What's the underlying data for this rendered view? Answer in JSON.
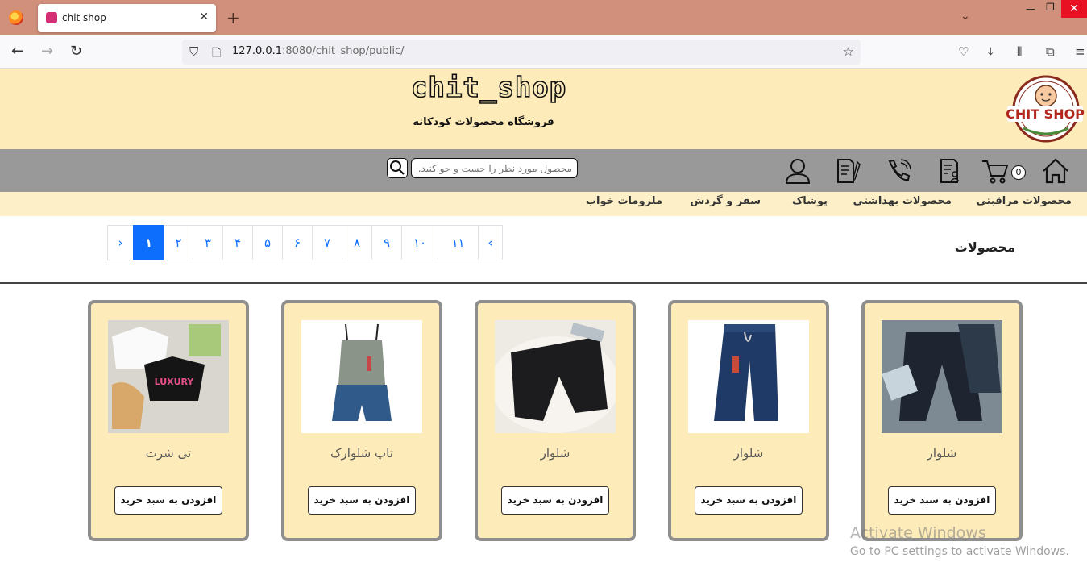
{
  "browser": {
    "tab_title": "chit shop",
    "url_host": "127.0.0.1",
    "url_rest": ":8080/chit_shop/public/",
    "accent": "#d0907c"
  },
  "site": {
    "brand": "chit_shop",
    "subtitle": "فروشگاه محصولات کودکانه",
    "logo_text": "CHIT SHOP",
    "header_bg": "#fdebb9",
    "iconbar_bg": "#999999",
    "search_placeholder": "محصول مورد نظر را جست و جو کنید...",
    "cart_count": "0",
    "icons": [
      "home-icon",
      "cart-icon",
      "document-user-icon",
      "phone-icon",
      "document-edit-icon",
      "user-icon",
      "search-icon"
    ]
  },
  "categories": [
    "محصولات مراقبتی",
    "محصولات بهداشتی",
    "پوشاک",
    "سفر و گردش",
    "ملزومات خواب"
  ],
  "products_heading": "محصولات",
  "pagination": {
    "prev": "‹",
    "next": "›",
    "pages": [
      "۱۱",
      "۱۰",
      "۹",
      "۸",
      "۷",
      "۶",
      "۵",
      "۴",
      "۳",
      "۲",
      "۱"
    ],
    "active": "۱"
  },
  "products": [
    {
      "name": "شلوار",
      "button": "افزودن به سبد خرید"
    },
    {
      "name": "شلوار",
      "button": "افزودن به سبد خرید"
    },
    {
      "name": "شلوار",
      "button": "افزودن به سبد خرید"
    },
    {
      "name": "تاپ شلوارک",
      "button": "افزودن به سبد خرید"
    },
    {
      "name": "تی شرت",
      "button": "افزودن به سبد خرید"
    }
  ],
  "watermark": {
    "line1": "Activate Windows",
    "line2": "Go to PC settings to activate Windows."
  }
}
